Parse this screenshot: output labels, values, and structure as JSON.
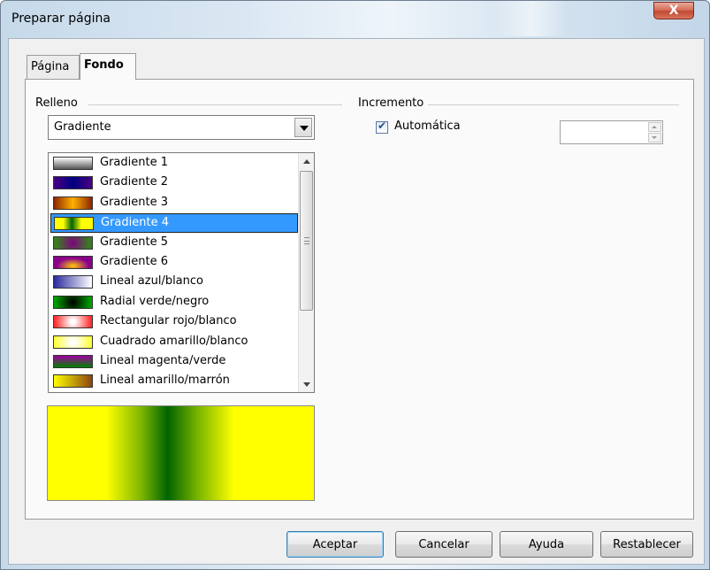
{
  "window": {
    "title": "Preparar página",
    "close_label": "X"
  },
  "tabs": [
    {
      "label": "Página",
      "active": false
    },
    {
      "label": "Fondo",
      "active": true
    }
  ],
  "relleno": {
    "group_label": "Relleno",
    "select_value": "Gradiente",
    "items": [
      {
        "label": "Gradiente 1",
        "swatch": "linear-gradient(180deg,#ffffff,#555555)",
        "selected": false
      },
      {
        "label": "Gradiente 2",
        "swatch": "linear-gradient(90deg,#4b0082,#000080,#4b0082)",
        "selected": false
      },
      {
        "label": "Gradiente 3",
        "swatch": "linear-gradient(90deg,#8b2500,#ffb000,#8b2500)",
        "selected": false
      },
      {
        "label": "Gradiente 4",
        "swatch": "linear-gradient(90deg,#ffff00 0%,#ffff00 22%,#006400 45%,#ffff00 70%,#ffff00 100%)",
        "selected": true
      },
      {
        "label": "Gradiente 5",
        "swatch": "radial-gradient(circle,#800080 0%,#3a7a22 80%)",
        "selected": false
      },
      {
        "label": "Gradiente 6",
        "swatch": "radial-gradient(ellipse at 50% 80%,#ffcc00 0%,#8b008b 60%)",
        "selected": false
      },
      {
        "label": "Lineal azul/blanco",
        "swatch": "linear-gradient(90deg,#2a2aa0,#ffffff)",
        "selected": false
      },
      {
        "label": "Radial verde/negro",
        "swatch": "radial-gradient(circle,#000000 0%,#00a000 90%)",
        "selected": false
      },
      {
        "label": "Rectangular rojo/blanco",
        "swatch": "radial-gradient(circle,#ffffff 10%,#ff3030 90%)",
        "selected": false
      },
      {
        "label": "Cuadrado amarillo/blanco",
        "swatch": "radial-gradient(circle,#ffffff 10%,#ffff40 90%)",
        "selected": false
      },
      {
        "label": "Lineal magenta/verde",
        "swatch": "linear-gradient(180deg,#a000a0,#008000)",
        "selected": false
      },
      {
        "label": "Lineal amarillo/marrón",
        "swatch": "linear-gradient(90deg,#ffff00,#8b4513)",
        "selected": false
      }
    ]
  },
  "incremento": {
    "group_label": "Incremento",
    "auto_label": "Automática",
    "auto_checked": true,
    "spin_value": ""
  },
  "buttons": {
    "aceptar": "Aceptar",
    "cancelar": "Cancelar",
    "ayuda": "Ayuda",
    "restablecer": "Restablecer"
  }
}
